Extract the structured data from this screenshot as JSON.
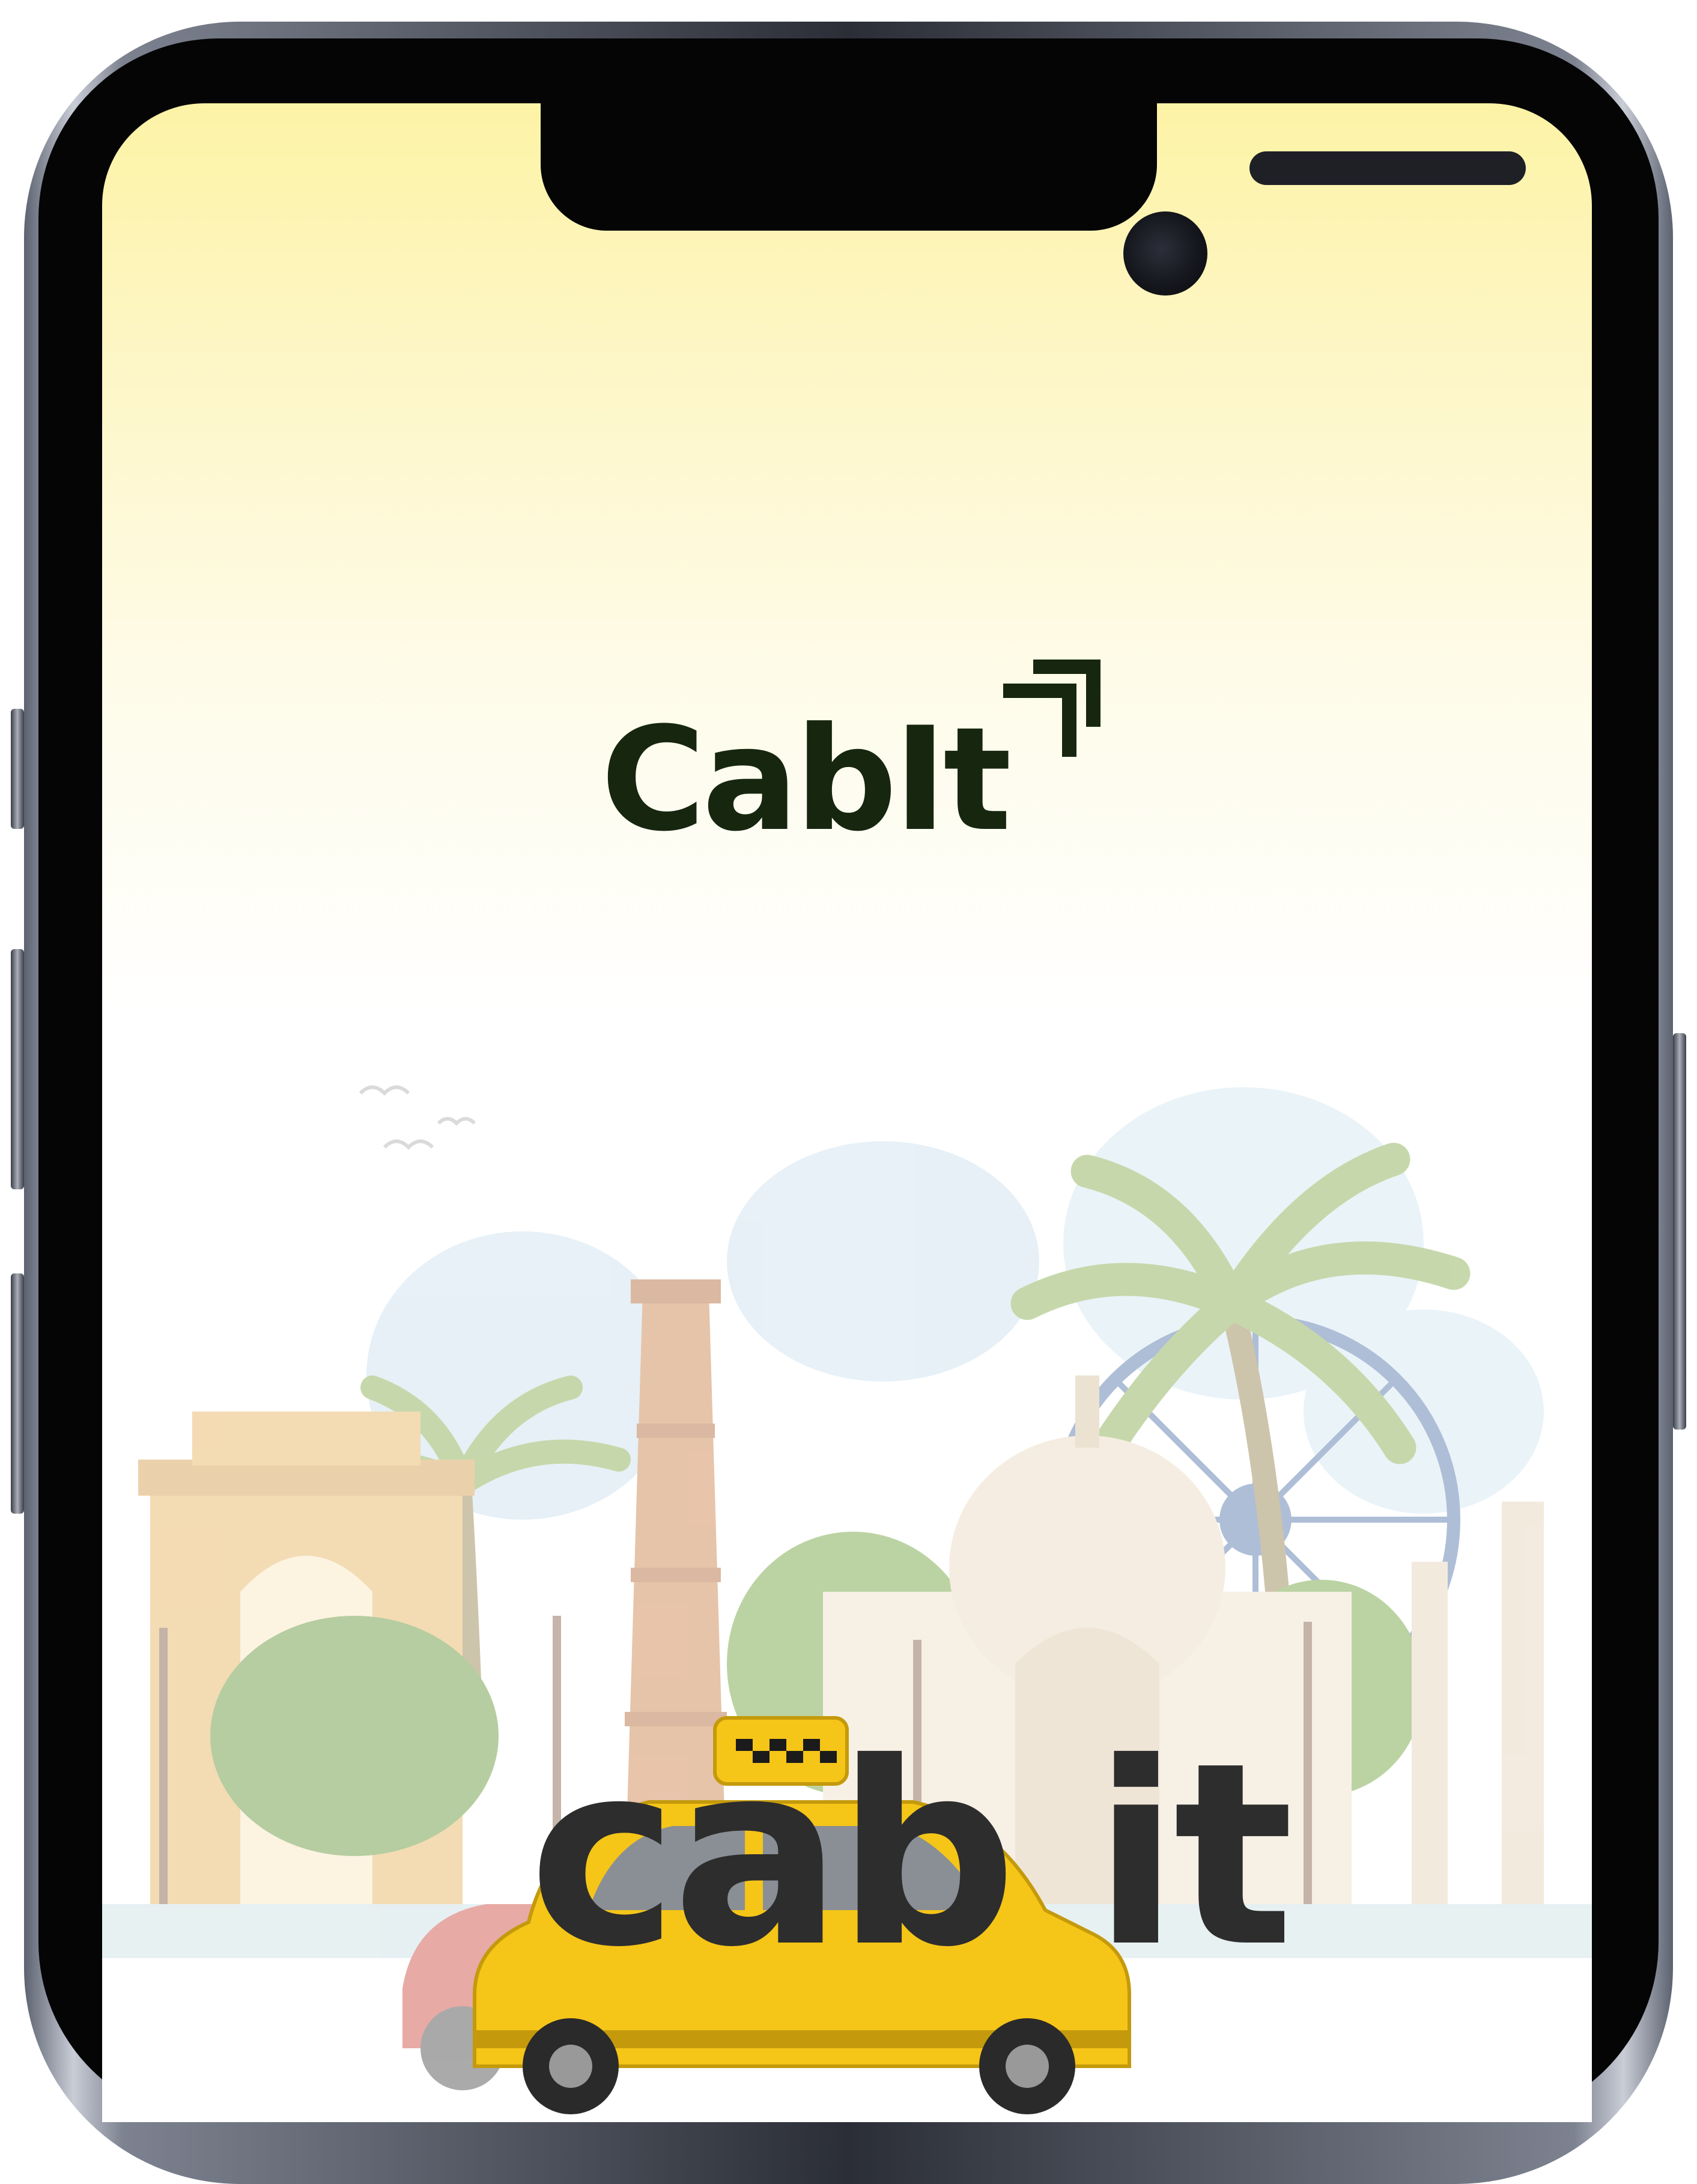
{
  "app": {
    "logo_text": "CabIt",
    "logo_icon": "double-arrow-up-right-icon",
    "brand_color": "#17260f",
    "background_top": "#fdf3a6"
  },
  "illustration": {
    "scene": "india-landmarks-skyline",
    "cab_logo_text": "cab it",
    "taxi_color": "#f5c518"
  }
}
